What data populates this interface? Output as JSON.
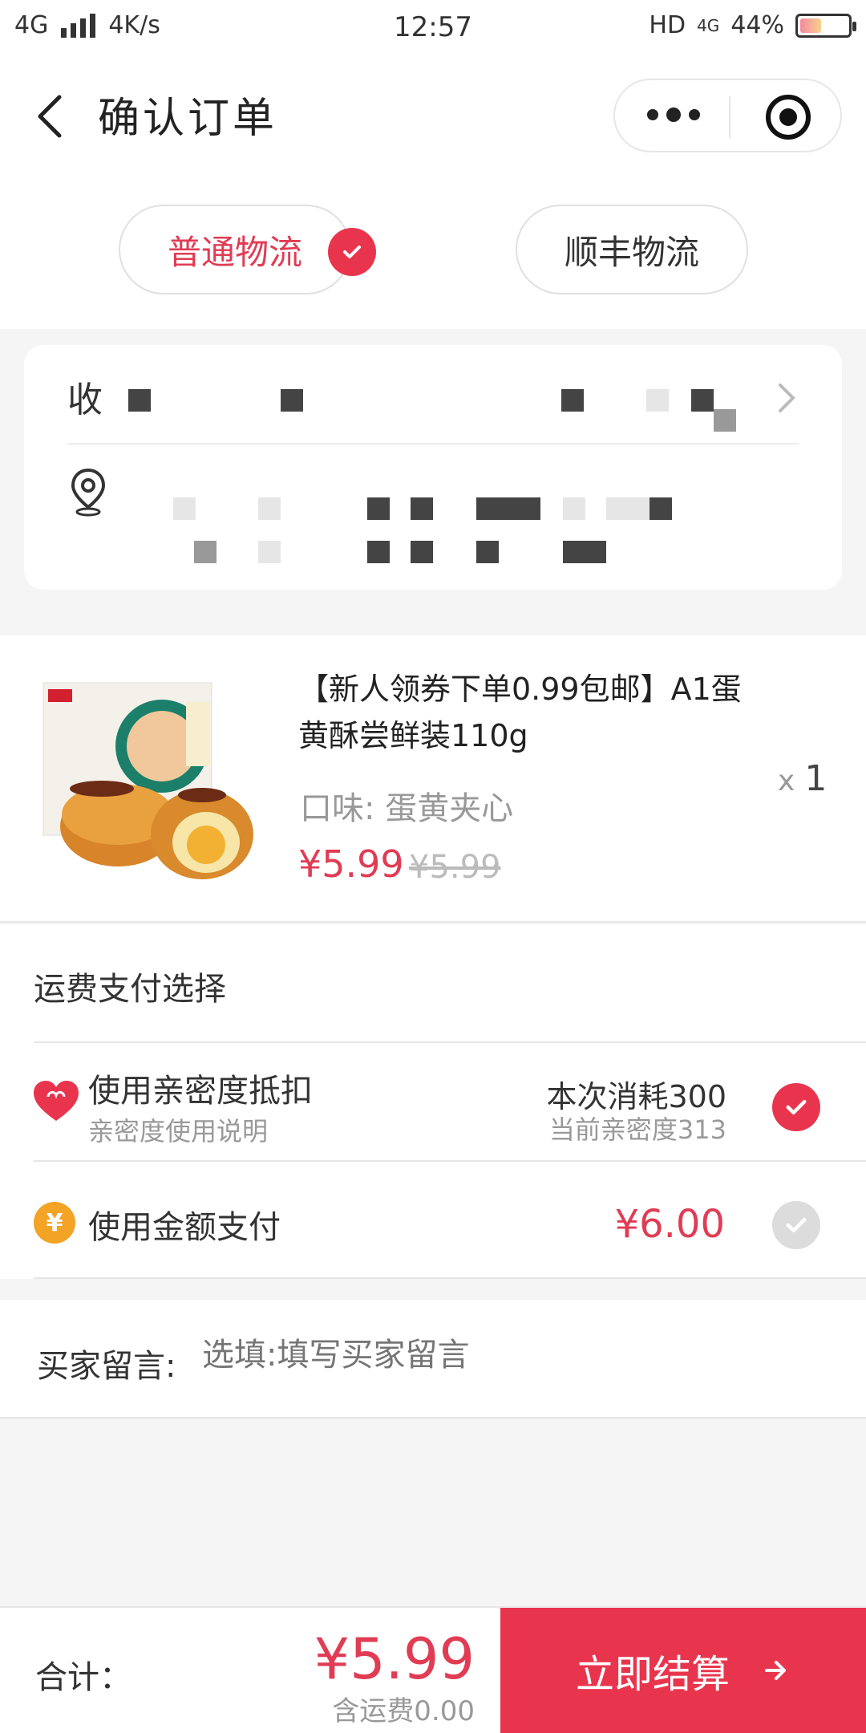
{
  "status_bar": {
    "network": "4G",
    "speed": "4K/s",
    "time": "12:57",
    "hd": "HD",
    "lte": "4G",
    "battery": "44%",
    "battery_level": 0.44
  },
  "nav": {
    "title": "确认订单",
    "back_icon": "chevron-left-icon",
    "more_icon": "more-dots-icon",
    "close_icon": "target-circle-icon"
  },
  "shipping": {
    "options": [
      {
        "label": "普通物流",
        "selected": true
      },
      {
        "label": "顺丰物流",
        "selected": false
      }
    ]
  },
  "address": {
    "recipient_label": "收"
  },
  "product": {
    "title": "【新人领券下单0.99包邮】A1蛋黄酥尝鲜装110g",
    "flavor": "口味: 蛋黄夹心",
    "price": "¥5.99",
    "original_price": "¥5.99",
    "qty_prefix": "x",
    "qty": "1"
  },
  "payment": {
    "title": "运费支付选择",
    "intimacy": {
      "label": "使用亲密度抵扣",
      "sub": "亲密度使用说明",
      "consume": "本次消耗300",
      "current": "当前亲密度313",
      "selected": true
    },
    "amount": {
      "icon": "¥",
      "label": "使用金额支付",
      "value": "¥6.00",
      "selected": false
    }
  },
  "message": {
    "label": "买家留言:",
    "placeholder": "选填:填写买家留言"
  },
  "bottom": {
    "total_label": "合计：",
    "total": "¥5.99",
    "shipping_note": "含运费0.00",
    "checkout": "立即结算"
  },
  "colors": {
    "accent": "#e8354d",
    "price": "#e03c54",
    "coin": "#f3a325"
  }
}
